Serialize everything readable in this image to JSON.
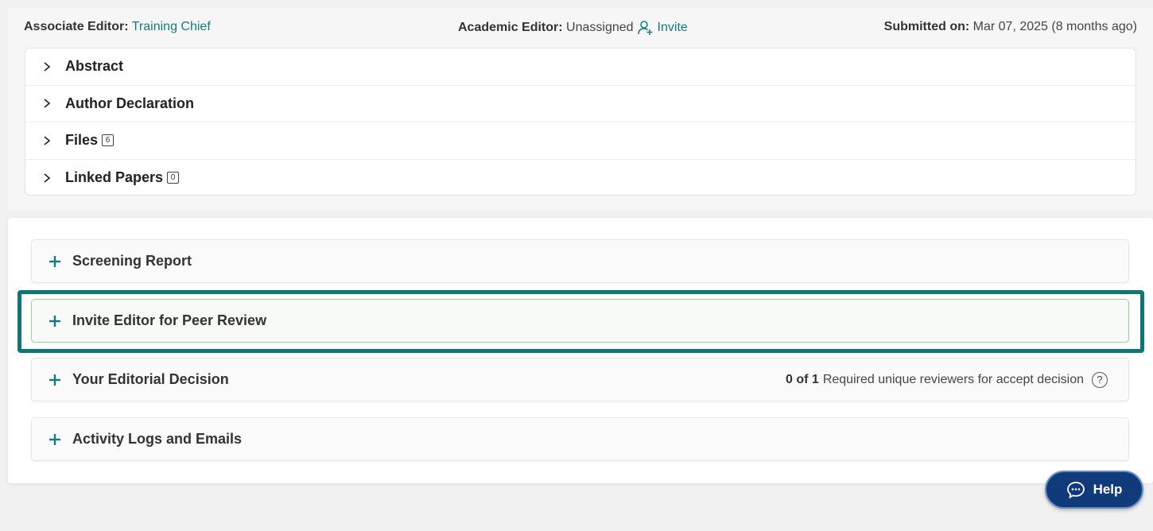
{
  "meta": {
    "associate_label": "Associate Editor:",
    "associate_value": "Training Chief",
    "academic_label": "Academic Editor:",
    "academic_value": "Unassigned",
    "invite_label": "Invite",
    "submitted_label": "Submitted on:",
    "submitted_value": "Mar 07, 2025 (8 months ago)"
  },
  "details": [
    {
      "label": "Abstract"
    },
    {
      "label": "Author Declaration"
    },
    {
      "label": "Files",
      "count": "6"
    },
    {
      "label": "Linked Papers",
      "count": "0"
    }
  ],
  "sections": {
    "screening": "Screening Report",
    "invite": "Invite Editor for Peer Review",
    "decision": "Your Editorial Decision",
    "decision_count": "0 of 1",
    "decision_note": "Required unique reviewers for accept decision",
    "activity": "Activity Logs and Emails"
  },
  "help_label": "Help",
  "icons": {
    "chevron": "chevron-right-icon",
    "plus": "plus-icon",
    "invite": "user-plus-icon",
    "question": "question-circle-icon",
    "chat": "chat-bubble-icon"
  },
  "colors": {
    "accent": "#137a83",
    "highlight": "#0f7575",
    "help_button": "#113a7a"
  }
}
